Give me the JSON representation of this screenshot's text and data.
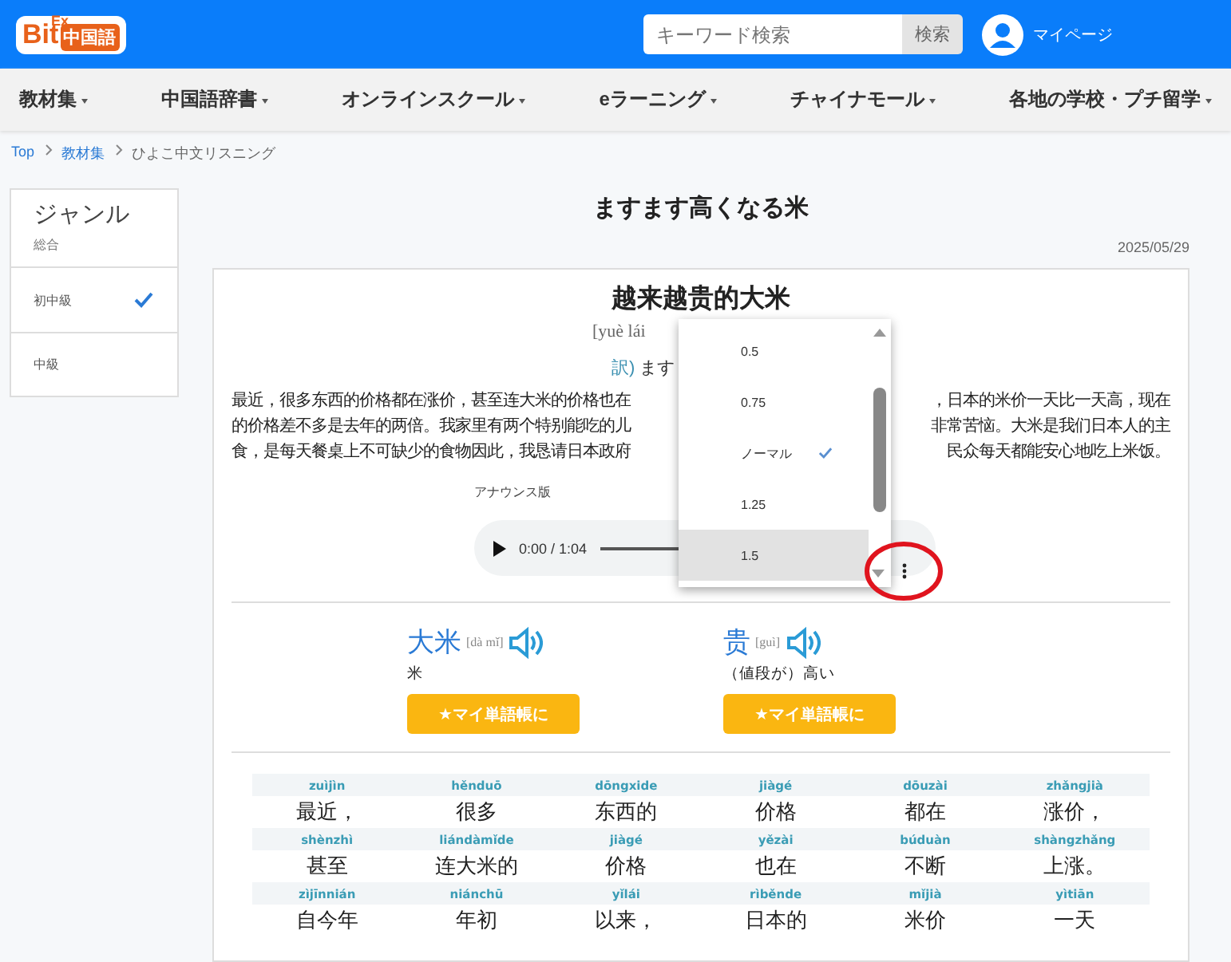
{
  "header": {
    "logo": {
      "top": "Ex",
      "main": "Bit",
      "sub": "中国語"
    },
    "search": {
      "placeholder": "キーワード検索",
      "button": "検索"
    },
    "account": "マイページ"
  },
  "nav": [
    "教材集",
    "中国語辞書",
    "オンラインスクール",
    "eラーニング",
    "チャイナモール",
    "各地の学校・プチ留学"
  ],
  "breadcrumb": [
    {
      "label": "Top",
      "link": true
    },
    {
      "label": "教材集",
      "link": true
    },
    {
      "label": "ひよこ中文リスニング",
      "link": false
    }
  ],
  "sidebar": {
    "title": "ジャンル",
    "subtitle": "総合",
    "items": [
      {
        "label": "初中級",
        "selected": true
      },
      {
        "label": "中級",
        "selected": false
      }
    ]
  },
  "article": {
    "title": "ますます高くなる米",
    "date": "2025/05/29",
    "chinese_title": "越来越贵的大米",
    "pinyin": "[yuè lái",
    "translation_mark": "訳)",
    "translation": "ます",
    "paragraph": [
      {
        "left": "最近，很多东西的价格都在涨价，甚至连大米的价格也在",
        "right": "，日本的米价一天比一天高，现在"
      },
      {
        "left": "的价格差不多是去年的两倍。我家里有两个特别能吃的儿",
        "right": "非常苦恼。大米是我们日本人的主"
      },
      {
        "left": "食，是每天餐桌上不可缺少的食物因此，我恳请日本政府",
        "right": "民众每天都能安心地吃上米饭。"
      }
    ],
    "audio": {
      "label": "アナウンス版",
      "time": "0:00 / 1:04"
    },
    "speed_menu": [
      {
        "label": "0.5",
        "selected": false,
        "highlighted": false
      },
      {
        "label": "0.75",
        "selected": false,
        "highlighted": false
      },
      {
        "label": "ノーマル",
        "selected": true,
        "highlighted": false
      },
      {
        "label": "1.25",
        "selected": false,
        "highlighted": false
      },
      {
        "label": "1.5",
        "selected": false,
        "highlighted": true
      }
    ],
    "vocab": [
      {
        "word": "大米",
        "pinyin": "[dà mǐ]",
        "meaning": "米",
        "button": "★マイ単語帳に"
      },
      {
        "word": "贵",
        "pinyin": "[guì]",
        "meaning": "（値段が）高い",
        "button": "★マイ単語帳に"
      }
    ],
    "reading_rows": [
      [
        {
          "pinyin": "zuìjìn",
          "text": "最近，"
        },
        {
          "pinyin": "hěnduō",
          "text": "很多"
        },
        {
          "pinyin": "dōngxide",
          "text": "东西的"
        },
        {
          "pinyin": "jiàgé",
          "text": "价格"
        },
        {
          "pinyin": "dōuzài",
          "text": "都在"
        },
        {
          "pinyin": "zhǎngjià",
          "text": "涨价，"
        }
      ],
      [
        {
          "pinyin": "shènzhì",
          "text": "甚至"
        },
        {
          "pinyin": "liándàmǐde",
          "text": "连大米的"
        },
        {
          "pinyin": "jiàgé",
          "text": "价格"
        },
        {
          "pinyin": "yězài",
          "text": "也在"
        },
        {
          "pinyin": "búduàn",
          "text": "不断"
        },
        {
          "pinyin": "shàngzhǎng",
          "text": "上涨。"
        }
      ],
      [
        {
          "pinyin": "zìjīnnián",
          "text": "自今年"
        },
        {
          "pinyin": "niánchū",
          "text": "年初"
        },
        {
          "pinyin": "yǐlái",
          "text": "以来，"
        },
        {
          "pinyin": "rìběnde",
          "text": "日本的"
        },
        {
          "pinyin": "mǐjià",
          "text": "米价"
        },
        {
          "pinyin": "yìtiān",
          "text": "一天"
        }
      ]
    ]
  }
}
